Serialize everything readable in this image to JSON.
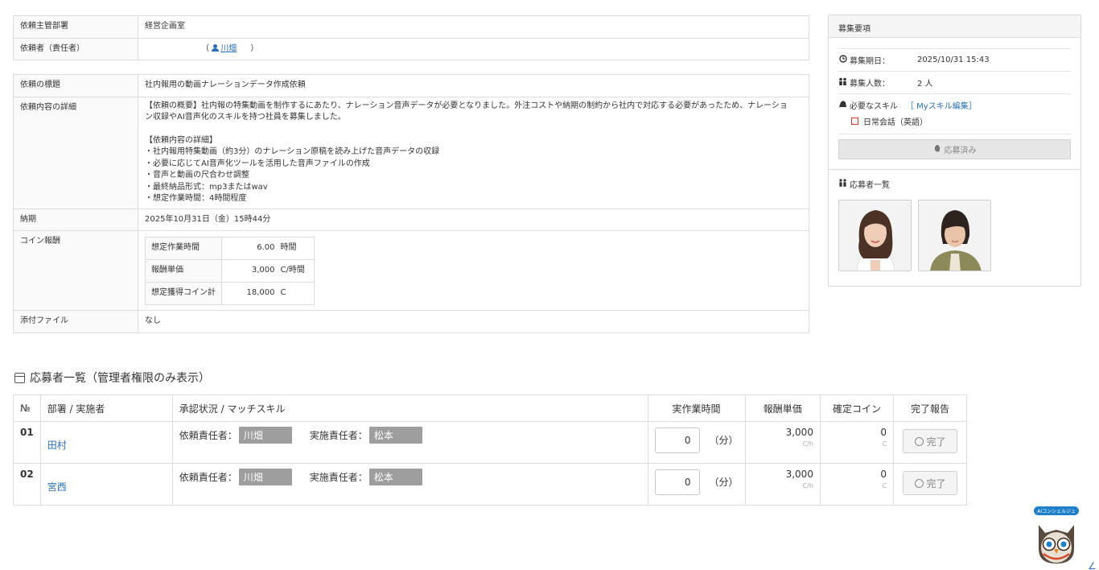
{
  "request_info": {
    "dept_label": "依頼主管部署",
    "dept_value": "経営企画室",
    "requester_label": "依頼者（責任者）",
    "requester_open": "（",
    "requester_name": "川畑",
    "requester_close": "）"
  },
  "request_detail": {
    "title_label": "依頼の標題",
    "title_value": "社内報用の動画ナレーションデータ作成依頼",
    "detail_label": "依頼内容の詳細",
    "detail_lines_1": [
      "【依頼の概要】社内報の特集動画を制作するにあたり、ナレーション音声データが必要となりました。外注コストや納期の制約から社内で対応する必要があったため、ナレーショ",
      "ン収録やAI音声化のスキルを持つ社員を募集しました。"
    ],
    "detail_lines_2": [
      "【依頼内容の詳細】",
      "・社内報用特集動画（約3分）のナレーション原稿を読み上げた音声データの収録",
      "・必要に応じてAI音声化ツールを活用した音声ファイルの作成",
      "・音声と動画の尺合わせ調整",
      "・最終納品形式：mp3またはwav",
      "・想定作業時間：4時間程度"
    ],
    "deadline_label": "納期",
    "deadline_value": "2025年10月31日（金）15時44分",
    "coin_label": "コイン報酬",
    "coin_rows": [
      {
        "label": "想定作業時間",
        "value": "6.00",
        "unit": "時間"
      },
      {
        "label": "報酬単価",
        "value": "3,000",
        "unit": "C/時間"
      },
      {
        "label": "想定獲得コイン計",
        "value": "18,000",
        "unit": "C"
      }
    ],
    "attachment_label": "添付ファイル",
    "attachment_value": "なし"
  },
  "recruit_panel": {
    "title": "募集要項",
    "deadline_label": "募集期日：",
    "deadline_value": "2025/10/31 15:43",
    "count_label": "募集人数：",
    "count_value": "2 人",
    "skill_label": "必要なスキル",
    "skill_link": "［ Myスキル編集］",
    "skill_item": "日常会話（英語）",
    "applied_button": "応募済み",
    "applicants_title": "応募者一覧",
    "icons": [
      "clock-icon",
      "people-icon",
      "skill-icon",
      "hand-icon",
      "group-icon"
    ]
  },
  "applicants_section": {
    "title": "応募者一覧（管理者権限のみ表示）",
    "headers": [
      "№",
      "部署 / 実施者",
      "承認状況 / マッチスキル",
      "実作業時間",
      "報酬単価",
      "確定コイン",
      "完了報告"
    ],
    "rows": [
      {
        "no": "01",
        "name": "田村",
        "requester_label": "依頼責任者：",
        "requester": "川畑",
        "executor_label": "実施責任者：",
        "executor": "松本",
        "time_value": "0",
        "time_unit": "（分）",
        "rate": "3,000",
        "rate_unit": "C/h",
        "coin": "0",
        "coin_unit": "C",
        "done_label": "完了"
      },
      {
        "no": "02",
        "name": "宮西",
        "requester_label": "依頼責任者：",
        "requester": "川畑",
        "executor_label": "実施責任者：",
        "executor": "松本",
        "time_value": "0",
        "time_unit": "（分）",
        "rate": "3,000",
        "rate_unit": "C/h",
        "coin": "0",
        "coin_unit": "C",
        "done_label": "完了"
      }
    ]
  },
  "concierge": {
    "label": "AIコンシェルジュ"
  },
  "colors": {
    "link": "#2a6fb8",
    "badge": "#9e9e9e",
    "skill_box": "#d9342b",
    "concierge": "#1f7fc8"
  }
}
